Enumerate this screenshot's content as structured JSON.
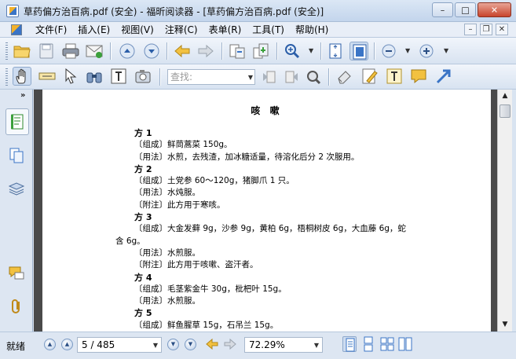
{
  "window": {
    "title": "草药偏方治百病.pdf (安全) - 福昕阅读器 - [草药偏方治百病.pdf (安全)]",
    "minimize": "–",
    "maximize": "□",
    "close": "✕"
  },
  "menu": {
    "items": [
      "文件(F)",
      "插入(E)",
      "视图(V)",
      "注释(C)",
      "表单(R)",
      "工具(T)",
      "帮助(H)"
    ],
    "mdi": [
      "–",
      "❐",
      "✕"
    ]
  },
  "toolbar": {
    "find_placeholder": "查找:"
  },
  "document": {
    "heading": "咳  嗽",
    "lines": [
      {
        "text": "方 1",
        "bold": true
      },
      {
        "text": "〔组成〕鲜茼蒿菜 150g。"
      },
      {
        "text": "〔用法〕水煎，去残渣，加冰糖适量，待溶化后分 2 次服用。"
      },
      {
        "text": "方 2",
        "bold": true
      },
      {
        "text": "〔组成〕土党参 60～120g，猪脚爪 1 只。"
      },
      {
        "text": "〔用法〕水炖服。"
      },
      {
        "text": "〔附注〕此方用于寒咳。"
      },
      {
        "text": "方 3",
        "bold": true
      },
      {
        "text": "〔组成〕大金发藓 9g，沙参 9g，黄柏 6g，梧桐树皮 6g，大血藤 6g，蛇"
      },
      {
        "text": "含 6g。",
        "cont": true
      },
      {
        "text": "〔用法〕水煎服。"
      },
      {
        "text": "〔附注〕此方用于咳嗽、盗汗者。"
      },
      {
        "text": "方 4",
        "bold": true
      },
      {
        "text": "〔组成〕毛茎紫金牛 30g，枇杷叶 15g。"
      },
      {
        "text": "〔用法〕水煎服。"
      },
      {
        "text": "方 5",
        "bold": true
      },
      {
        "text": "〔组成〕鲜鱼腥草 15g，石吊兰 15g。"
      }
    ]
  },
  "statusbar": {
    "status": "就绪",
    "page_indicator": "5 / 485",
    "zoom": "72.29%"
  },
  "colors": {
    "accent": "#3a74c6",
    "chrome": "#dde6f2",
    "viewer_bg": "#4a4a4a"
  }
}
